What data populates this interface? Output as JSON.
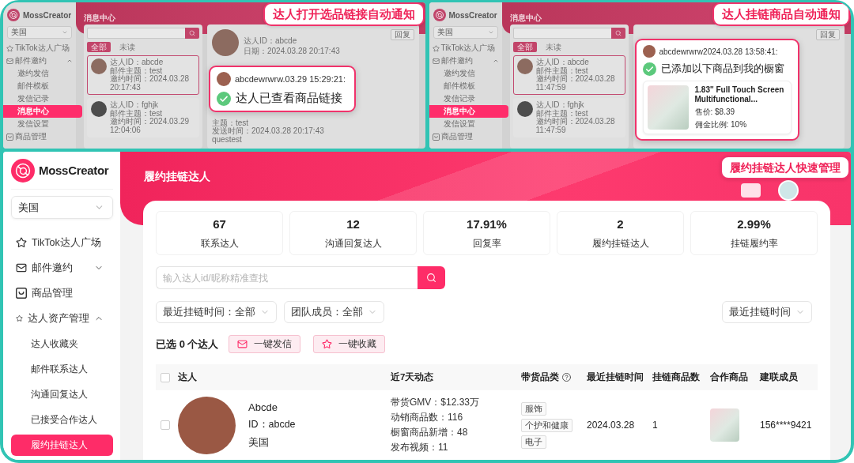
{
  "top_panels": [
    {
      "callout": "达人打开选品链接自动通知",
      "app": {
        "logo": "MossCreator",
        "region": "美国",
        "page_title": "消息中心",
        "menu": [
          {
            "label": "TikTok达人广场",
            "kind": "link"
          },
          {
            "label": "邮件邀约",
            "kind": "group",
            "expanded": true,
            "children": [
              {
                "label": "邀约发信",
                "selected": false
              },
              {
                "label": "邮件模板",
                "selected": false
              },
              {
                "label": "发信记录",
                "selected": false
              },
              {
                "label": "消息中心",
                "selected": true
              },
              {
                "label": "发信设置",
                "selected": false
              }
            ]
          },
          {
            "label": "商品管理",
            "kind": "link"
          }
        ],
        "tabs": [
          {
            "label": "全部",
            "selected": true
          },
          {
            "label": "未读",
            "selected": false
          }
        ],
        "messages": [
          {
            "selected": true,
            "lines": [
              "达人ID：abcde",
              "邮件主题：test",
              "邀约时间：2024.03.28 20:17:43"
            ]
          },
          {
            "selected": false,
            "lines": [
              "达人ID：fghjk",
              "邮件主题：test",
              "邀约时间：2024.03.29 12:04:06"
            ]
          }
        ],
        "detail": {
          "reply": "回复",
          "header_lines": [
            "达人ID：abcde",
            "日期：2024.03.28 20:17:43"
          ],
          "body_lines": [
            "主题：test",
            "发送时间：2024.03.28 20:17:43",
            "questest"
          ]
        }
      },
      "notification": {
        "kind": "viewed",
        "sender": "abcdewrwrw.03.29 15:29:21:",
        "message": "达人已查看商品链接"
      }
    },
    {
      "callout": "达人挂链商品自动通知",
      "app": {
        "logo": "MossCreator",
        "region": "美国",
        "page_title": "消息中心",
        "menu": [
          {
            "label": "TikTok达人广场",
            "kind": "link"
          },
          {
            "label": "邮件邀约",
            "kind": "group",
            "expanded": true,
            "children": [
              {
                "label": "邀约发信",
                "selected": false
              },
              {
                "label": "邮件模板",
                "selected": false
              },
              {
                "label": "发信记录",
                "selected": false
              },
              {
                "label": "消息中心",
                "selected": true
              },
              {
                "label": "发信设置",
                "selected": false
              }
            ]
          },
          {
            "label": "商品管理",
            "kind": "link"
          }
        ],
        "tabs": [
          {
            "label": "全部",
            "selected": true
          },
          {
            "label": "未读",
            "selected": false
          }
        ],
        "messages": [
          {
            "selected": true,
            "lines": [
              "达人ID：abcde",
              "邮件主题：test",
              "邀约时间：2024.03.28 11:47:59"
            ]
          },
          {
            "selected": false,
            "lines": [
              "达人ID：fghjk",
              "邮件主题：test",
              "邀约时间：2024.03.28 11:47:59"
            ]
          }
        ],
        "detail": {
          "reply": "回复"
        }
      },
      "notification": {
        "kind": "product",
        "sender": "abcdewrwrw2024.03.28 13:58:41:",
        "message": "已添加以下商品到我的橱窗",
        "product": {
          "title": "1.83'' Full Touch Screen Multifunctional...",
          "price": "售价: $8.39",
          "commission": "佣金比例: 10%"
        }
      }
    }
  ],
  "main": {
    "callout": "履约挂链达人快速管理",
    "sidebar": {
      "logo": "MossCreator",
      "region": "美国",
      "menu": [
        {
          "label": "TikTok达人广场",
          "kind": "link"
        },
        {
          "label": "邮件邀约",
          "kind": "group",
          "expanded": false
        },
        {
          "label": "商品管理",
          "kind": "link"
        },
        {
          "label": "达人资产管理",
          "kind": "group",
          "expanded": true,
          "children": [
            {
              "label": "达人收藏夹",
              "selected": false
            },
            {
              "label": "邮件联系达人",
              "selected": false
            },
            {
              "label": "沟通回复达人",
              "selected": false
            },
            {
              "label": "已接受合作达人",
              "selected": false
            },
            {
              "label": "履约挂链达人",
              "selected": true
            }
          ]
        }
      ]
    },
    "page_title": "履约挂链达人",
    "stats": [
      {
        "value": "67",
        "label": "联系达人"
      },
      {
        "value": "12",
        "label": "沟通回复达人"
      },
      {
        "value": "17.91%",
        "label": "回复率"
      },
      {
        "value": "2",
        "label": "履约挂链达人"
      },
      {
        "value": "2.99%",
        "label": "挂链履约率"
      }
    ],
    "search": {
      "placeholder": "输入达人id/昵称精准查找"
    },
    "filters": [
      {
        "label": "最近挂链时间：全部"
      },
      {
        "label": "团队成员：全部"
      }
    ],
    "sort": {
      "label": "最近挂链时间"
    },
    "selection": "已选 **0** 个达人",
    "bulk_actions": [
      "一键发信",
      "一键收藏"
    ],
    "table": {
      "all_checked": false,
      "columns": [
        {
          "label": "达人",
          "help": false
        },
        {
          "label": "近7天动态",
          "help": false
        },
        {
          "label": "带货品类",
          "help": true
        },
        {
          "label": "最近挂链时间",
          "help": false
        },
        {
          "label": "挂链商品数",
          "help": false
        },
        {
          "label": "合作商品",
          "help": false
        },
        {
          "label": "建联成员",
          "help": false
        }
      ],
      "rows": [
        {
          "checked": false,
          "name": "Abcde",
          "id": "ID：abcde",
          "country": "美国",
          "activity": [
            "带货GMV：$12.33万",
            "动销商品数：116",
            "橱窗商品新增：48",
            "发布视频：11"
          ],
          "categories": [
            "服饰",
            "个护和健康",
            "电子"
          ],
          "last_linked": "2024.03.28",
          "linked_count": "1",
          "member": "156****9421"
        }
      ]
    }
  }
}
